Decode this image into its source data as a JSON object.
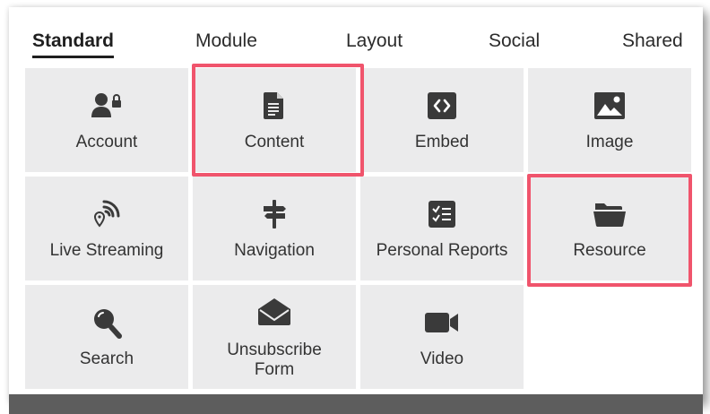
{
  "tabs": [
    {
      "label": "Standard",
      "active": true
    },
    {
      "label": "Module",
      "active": false
    },
    {
      "label": "Layout",
      "active": false
    },
    {
      "label": "Social",
      "active": false
    },
    {
      "label": "Shared",
      "active": false
    }
  ],
  "tiles": [
    {
      "label": "Account",
      "icon": "account-lock-icon"
    },
    {
      "label": "Content",
      "icon": "document-icon"
    },
    {
      "label": "Embed",
      "icon": "code-brackets-icon"
    },
    {
      "label": "Image",
      "icon": "image-icon"
    },
    {
      "label": "Live Streaming",
      "icon": "live-streaming-icon"
    },
    {
      "label": "Navigation",
      "icon": "signpost-icon"
    },
    {
      "label": "Personal Reports",
      "icon": "checklist-icon"
    },
    {
      "label": "Resource",
      "icon": "folder-open-icon"
    },
    {
      "label": "Search",
      "icon": "search-icon"
    },
    {
      "label": "Unsubscribe Form",
      "label_line1": "Unsubscribe",
      "label_line2": "Form",
      "icon": "envelope-open-icon"
    },
    {
      "label": "Video",
      "icon": "video-camera-icon"
    }
  ],
  "highlighted_tiles": [
    "Content",
    "Resource"
  ],
  "colors": {
    "highlight": "#f0546c",
    "tile_bg": "#ebebec",
    "icon": "#3a3a3a",
    "text": "#333333"
  }
}
